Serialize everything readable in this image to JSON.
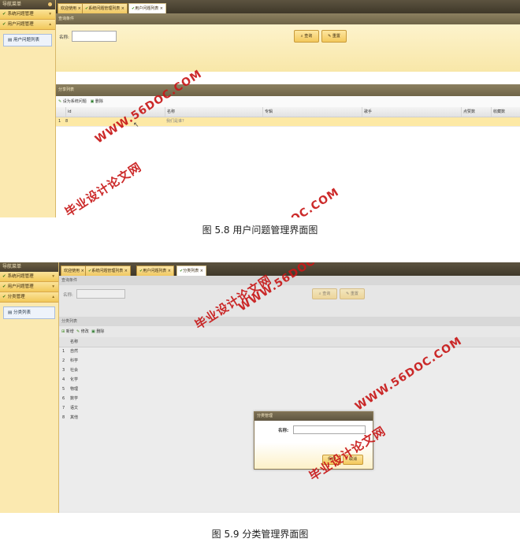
{
  "fig1": {
    "sidebar": {
      "title": "导航菜单",
      "groups": [
        {
          "label": "系统问题管理"
        },
        {
          "label": "用户问题管理"
        }
      ],
      "leaf": "用户问题列表"
    },
    "tabs": [
      "欢迎使用",
      "系统问题管理列表",
      "用户问题列表"
    ],
    "query": {
      "band": "查询条件",
      "name_label": "名称:",
      "search": "查询",
      "reset": "重置"
    },
    "list": {
      "band": "分享列表",
      "toolbar": [
        "设为系统问题",
        "删除"
      ],
      "columns": [
        "id",
        "名称",
        "专辑",
        "歌手",
        "点赞数",
        "收藏数"
      ],
      "rows": [
        {
          "num": "1",
          "id": "8",
          "name": "我们是谁?"
        }
      ]
    },
    "caption": "图 5.8 用户问题管理界面图"
  },
  "fig2": {
    "sidebar": {
      "title": "导航菜单",
      "groups": [
        {
          "label": "系统问题管理"
        },
        {
          "label": "用户问题管理"
        },
        {
          "label": "分类管理"
        }
      ],
      "leaf": "分类列表"
    },
    "tabs": [
      "欢迎使用",
      "系统问题管理列表",
      "用户问题列表",
      "分类列表"
    ],
    "query": {
      "band": "查询条件",
      "name_label": "名称:",
      "search": "查询",
      "reset": "重置"
    },
    "list": {
      "band": "分类列表",
      "toolbar": [
        "新增",
        "修改",
        "删除"
      ],
      "column": "名称",
      "rows": [
        {
          "num": "1",
          "name": "自然"
        },
        {
          "num": "2",
          "name": "科学"
        },
        {
          "num": "3",
          "name": "社会"
        },
        {
          "num": "4",
          "name": "化学"
        },
        {
          "num": "5",
          "name": "物理"
        },
        {
          "num": "6",
          "name": "数学"
        },
        {
          "num": "7",
          "name": "语文"
        },
        {
          "num": "8",
          "name": "其他"
        }
      ]
    },
    "dialog": {
      "title": "分类管理",
      "name_label": "名称:",
      "ok": "保存",
      "cancel": "取消"
    },
    "caption": "图 5.9 分类管理界面图"
  },
  "watermark": {
    "cn": "毕业设计论文网",
    "url": "WWW.56DOC.COM",
    "color": "#c81818"
  }
}
